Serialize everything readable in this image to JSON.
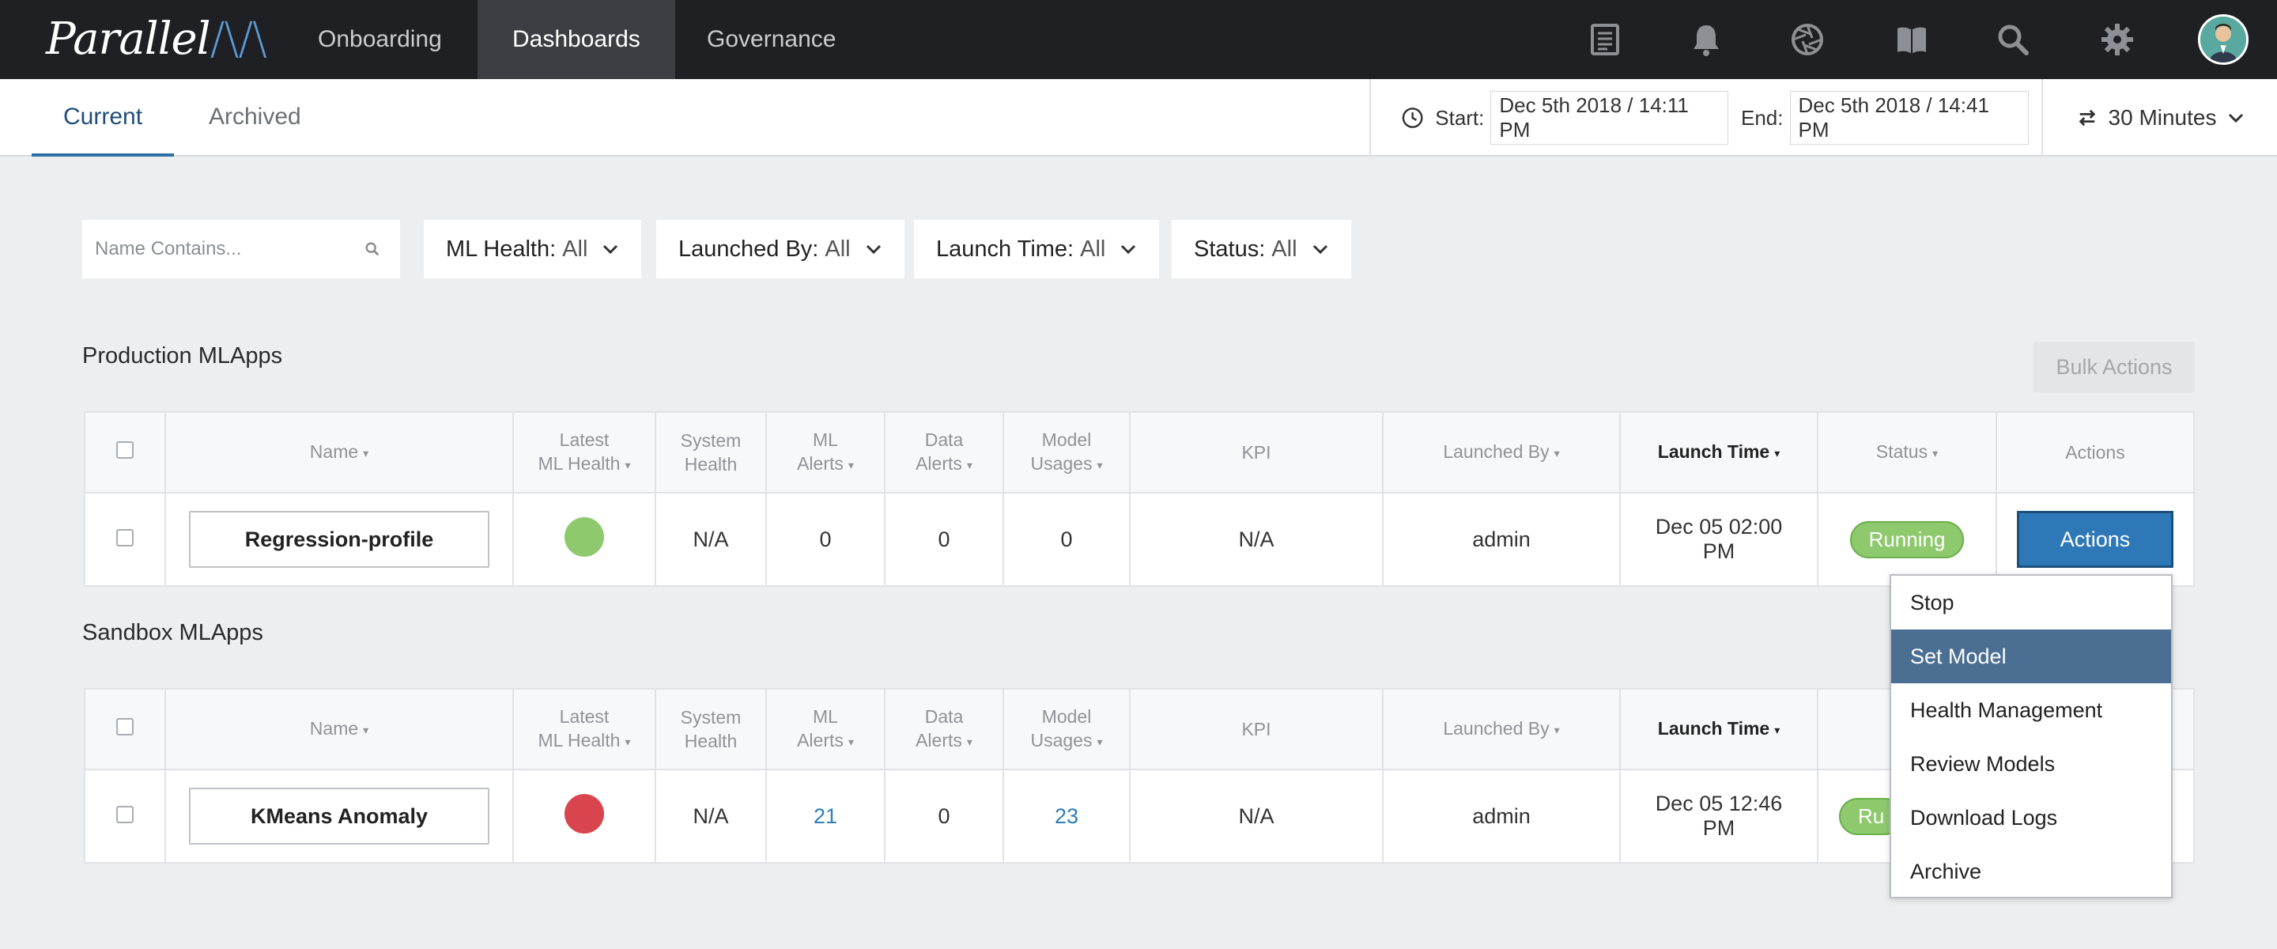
{
  "brand": {
    "name": "Parallel",
    "mark": "/\\/\\"
  },
  "nav": {
    "items": [
      {
        "label": "Onboarding",
        "active": false
      },
      {
        "label": "Dashboards",
        "active": true
      },
      {
        "label": "Governance",
        "active": false
      }
    ],
    "icons": [
      "logs-icon",
      "bell-icon",
      "aperture-icon",
      "book-icon",
      "search-icon",
      "gear-icon",
      "user-avatar"
    ]
  },
  "subnav": {
    "tabs": [
      {
        "label": "Current",
        "active": true
      },
      {
        "label": "Archived",
        "active": false
      }
    ],
    "time": {
      "start_label": "Start:",
      "start_value": "Dec 5th 2018 / 14:11 PM",
      "end_label": "End:",
      "end_value": "Dec 5th 2018 / 14:41 PM"
    },
    "interval": "30 Minutes"
  },
  "filters": {
    "search_placeholder": "Name Contains...",
    "items": [
      {
        "label": "ML Health:",
        "value": "All"
      },
      {
        "label": "Launched By:",
        "value": "All"
      },
      {
        "label": "Launch Time:",
        "value": "All"
      },
      {
        "label": "Status:",
        "value": "All"
      }
    ]
  },
  "colors": {
    "accent": "#2f6fa8",
    "health_good": "#8ec96e",
    "health_bad": "#d9454e",
    "status_running": "#8ec96e",
    "actions_btn": "#2f78b7",
    "menu_active": "#4a6f93"
  },
  "columns": {
    "name": "Name",
    "ml_health_1": "Latest",
    "ml_health_2": "ML Health",
    "sys_health_1": "System",
    "sys_health_2": "Health",
    "ml_alerts_1": "ML",
    "ml_alerts_2": "Alerts",
    "data_alerts_1": "Data",
    "data_alerts_2": "Alerts",
    "model_usages_1": "Model",
    "model_usages_2": "Usages",
    "kpi": "KPI",
    "launched_by": "Launched By",
    "launch_time": "Launch Time",
    "status": "Status",
    "actions": "Actions"
  },
  "production": {
    "title": "Production MLApps",
    "bulk_actions": "Bulk Actions",
    "rows": [
      {
        "name": "Regression-profile",
        "ml_health": "good",
        "system_health": "N/A",
        "ml_alerts": "0",
        "data_alerts": "0",
        "model_usages": "0",
        "kpi": "N/A",
        "launched_by": "admin",
        "launch_time_1": "Dec 05 02:00",
        "launch_time_2": "PM",
        "status": "Running",
        "action": "Actions"
      }
    ]
  },
  "sandbox": {
    "title": "Sandbox MLApps",
    "rows": [
      {
        "name": "KMeans Anomaly",
        "ml_health": "bad",
        "system_health": "N/A",
        "ml_alerts": "21",
        "data_alerts": "0",
        "model_usages": "23",
        "kpi": "N/A",
        "launched_by": "admin",
        "launch_time_1": "Dec 05 12:46",
        "launch_time_2": "PM",
        "status": "Ru",
        "status_header_partial": "St"
      }
    ]
  },
  "actions_menu": {
    "items": [
      "Stop",
      "Set Model",
      "Health Management",
      "Review Models",
      "Download Logs",
      "Archive"
    ],
    "highlighted": "Set Model"
  }
}
